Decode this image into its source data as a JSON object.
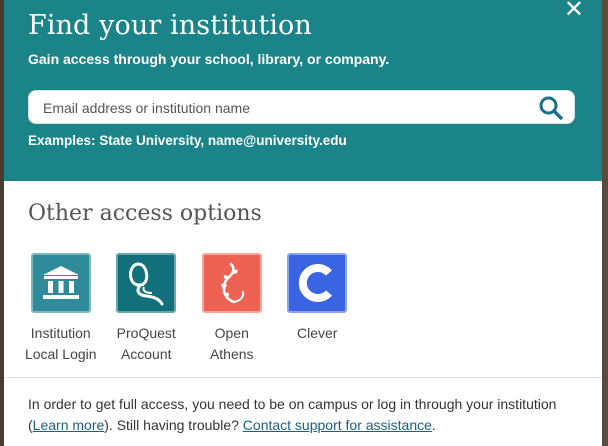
{
  "modal": {
    "title": "Find your institution",
    "subtitle": "Gain access through your school, library, or company.",
    "search": {
      "placeholder": "Email address or institution name",
      "value": ""
    },
    "examples": "Examples: State University, name@university.edu",
    "close_icon": "close-icon"
  },
  "other_options": {
    "title": "Other access options",
    "items": [
      {
        "label": "Institution\nLocal Login",
        "icon": "institution-icon",
        "color": "#2f8a99"
      },
      {
        "label": "ProQuest\nAccount",
        "icon": "proquest-icon",
        "color": "#12707a"
      },
      {
        "label": "Open\nAthens",
        "icon": "openathens-icon",
        "color": "#ee6254"
      },
      {
        "label": "Clever",
        "icon": "clever-icon",
        "color": "#3b64e3"
      }
    ]
  },
  "footer": {
    "text_before": "In order to get full access, you need to be on campus or log in through your institution (",
    "learn_more": "Learn more",
    "text_middle": "). Still having trouble? ",
    "contact": "Contact support for assistance",
    "text_after": "."
  },
  "colors": {
    "header_bg": "#1b8489",
    "link": "#1a5f8a"
  }
}
